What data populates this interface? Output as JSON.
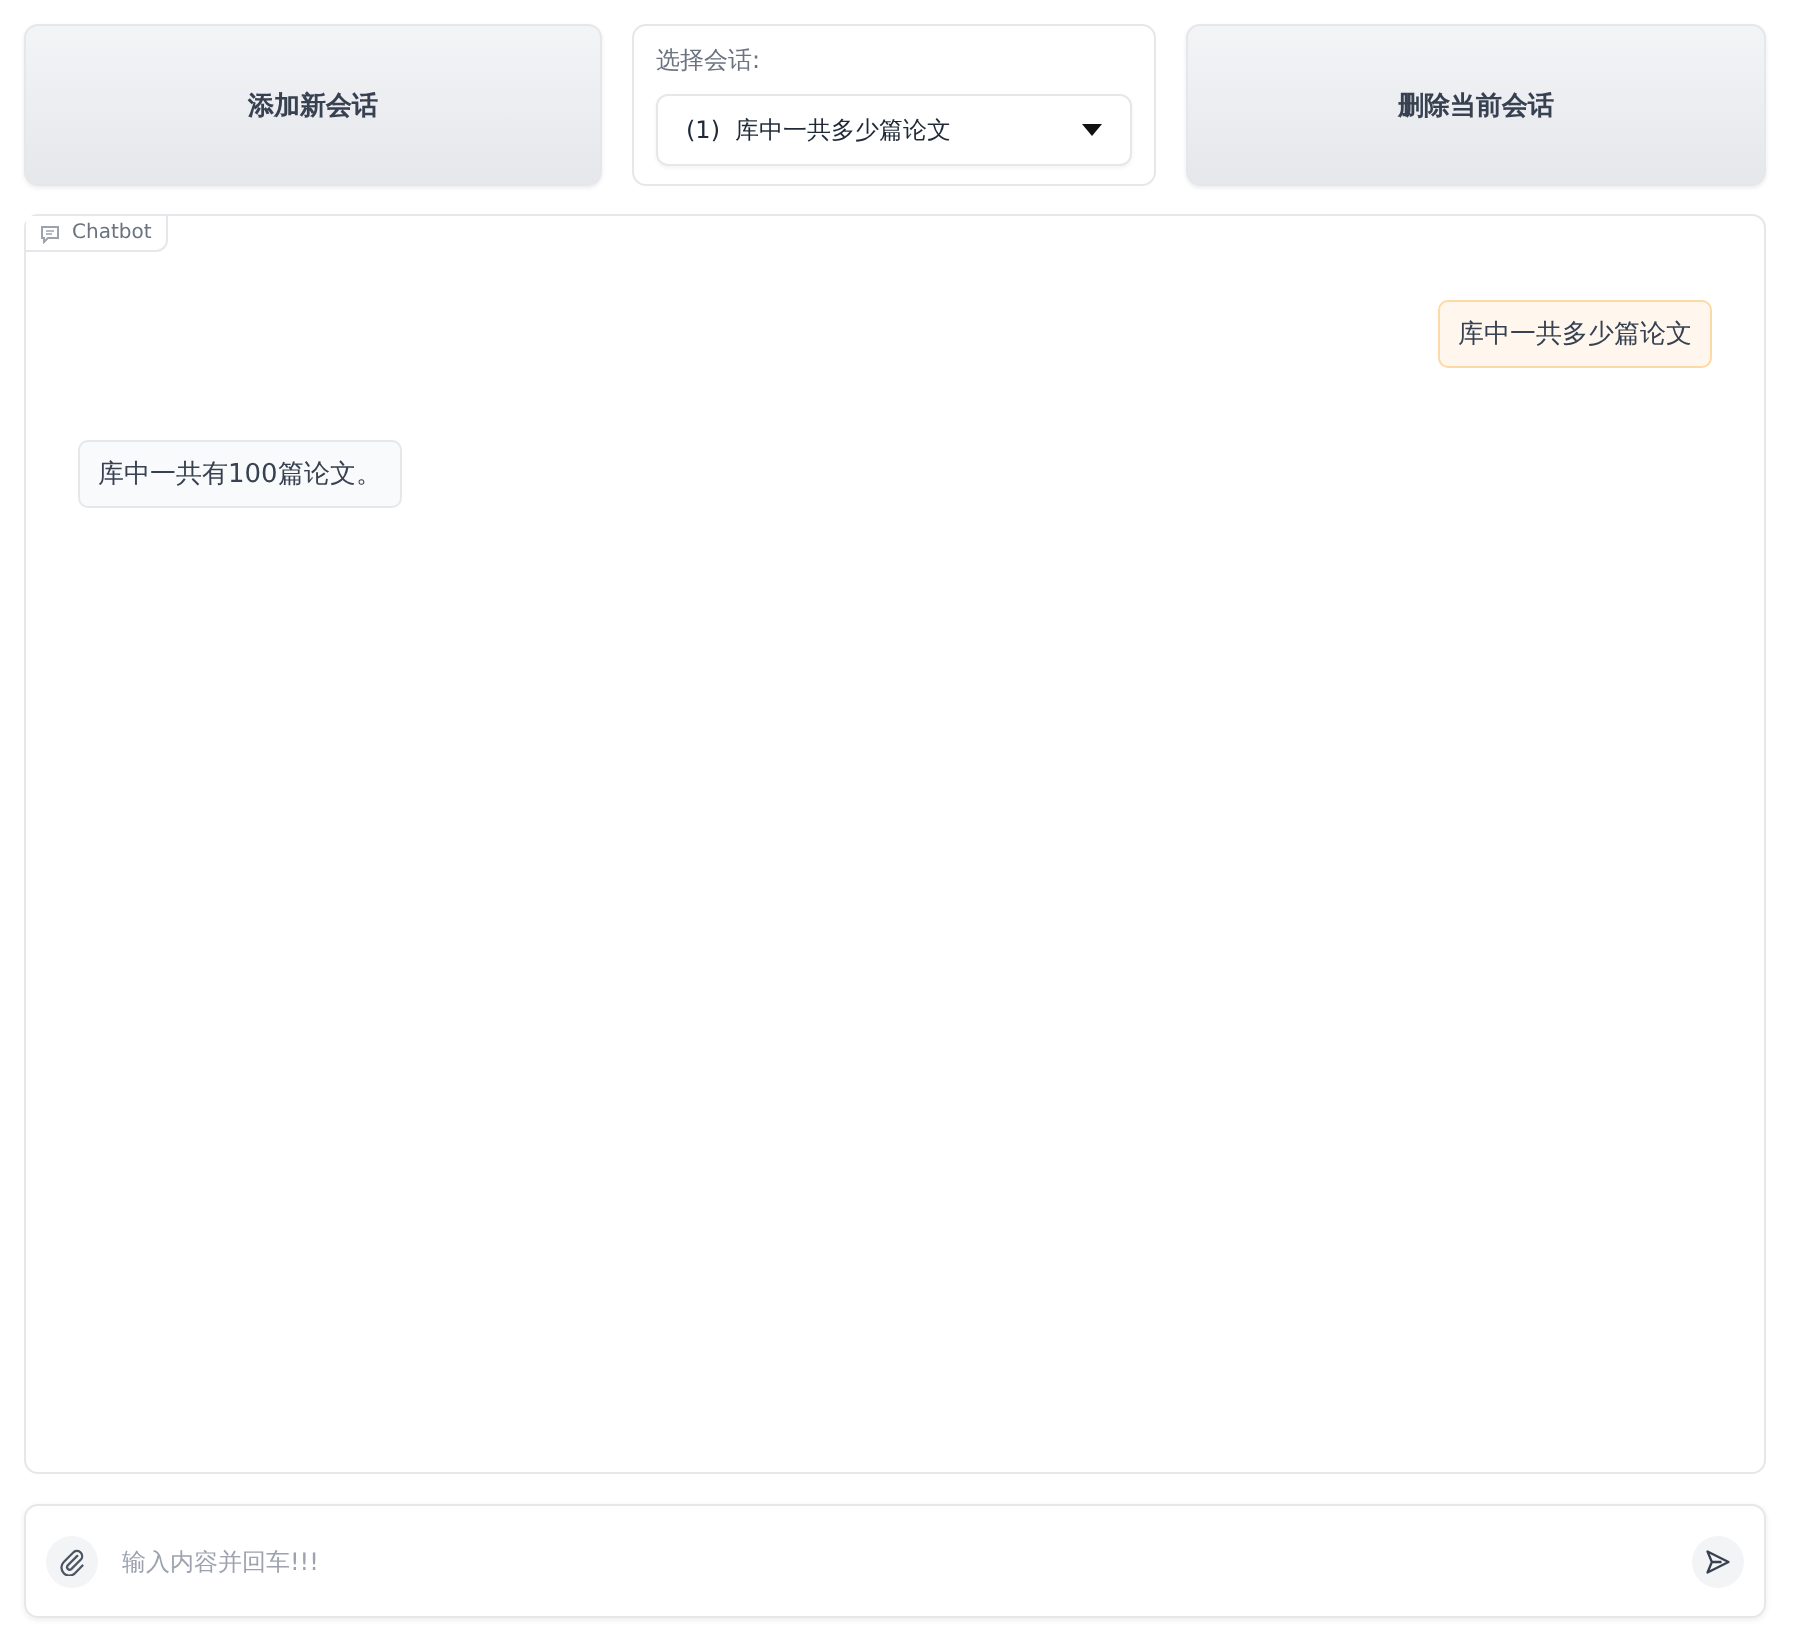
{
  "top_bar": {
    "add_button": "添加新会话",
    "session_select": {
      "label": "选择会话:",
      "value": "(1)  库中一共多少篇论文"
    },
    "delete_button": "删除当前会话"
  },
  "chatbot": {
    "label": "Chatbot",
    "messages": [
      {
        "kind": "user",
        "text": "库中一共多少篇论文"
      },
      {
        "kind": "bot",
        "text": "库中一共有100篇论文。"
      }
    ]
  },
  "input": {
    "placeholder": "输入内容并回车!!!"
  }
}
